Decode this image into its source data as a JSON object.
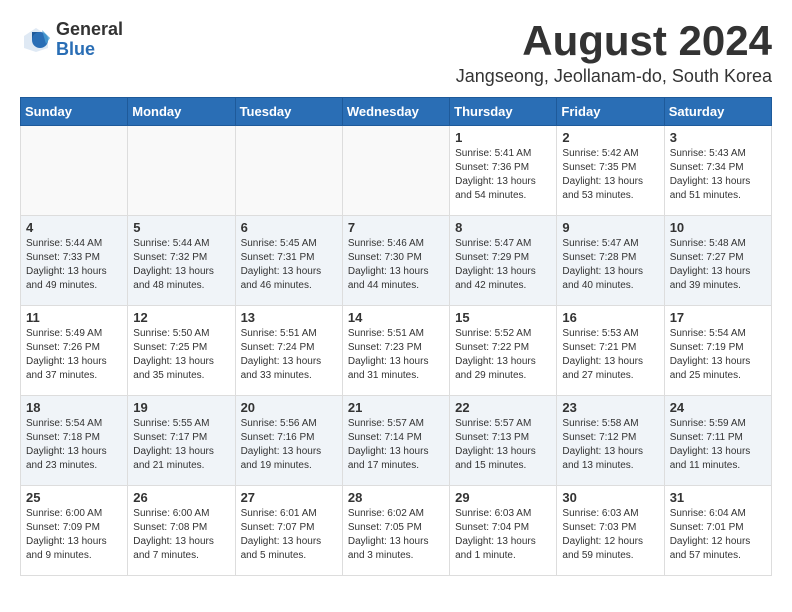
{
  "logo": {
    "line1": "General",
    "line2": "Blue"
  },
  "title": "August 2024",
  "location": "Jangseong, Jeollanam-do, South Korea",
  "headers": [
    "Sunday",
    "Monday",
    "Tuesday",
    "Wednesday",
    "Thursday",
    "Friday",
    "Saturday"
  ],
  "weeks": [
    [
      {
        "day": "",
        "info": ""
      },
      {
        "day": "",
        "info": ""
      },
      {
        "day": "",
        "info": ""
      },
      {
        "day": "",
        "info": ""
      },
      {
        "day": "1",
        "info": "Sunrise: 5:41 AM\nSunset: 7:36 PM\nDaylight: 13 hours\nand 54 minutes."
      },
      {
        "day": "2",
        "info": "Sunrise: 5:42 AM\nSunset: 7:35 PM\nDaylight: 13 hours\nand 53 minutes."
      },
      {
        "day": "3",
        "info": "Sunrise: 5:43 AM\nSunset: 7:34 PM\nDaylight: 13 hours\nand 51 minutes."
      }
    ],
    [
      {
        "day": "4",
        "info": "Sunrise: 5:44 AM\nSunset: 7:33 PM\nDaylight: 13 hours\nand 49 minutes."
      },
      {
        "day": "5",
        "info": "Sunrise: 5:44 AM\nSunset: 7:32 PM\nDaylight: 13 hours\nand 48 minutes."
      },
      {
        "day": "6",
        "info": "Sunrise: 5:45 AM\nSunset: 7:31 PM\nDaylight: 13 hours\nand 46 minutes."
      },
      {
        "day": "7",
        "info": "Sunrise: 5:46 AM\nSunset: 7:30 PM\nDaylight: 13 hours\nand 44 minutes."
      },
      {
        "day": "8",
        "info": "Sunrise: 5:47 AM\nSunset: 7:29 PM\nDaylight: 13 hours\nand 42 minutes."
      },
      {
        "day": "9",
        "info": "Sunrise: 5:47 AM\nSunset: 7:28 PM\nDaylight: 13 hours\nand 40 minutes."
      },
      {
        "day": "10",
        "info": "Sunrise: 5:48 AM\nSunset: 7:27 PM\nDaylight: 13 hours\nand 39 minutes."
      }
    ],
    [
      {
        "day": "11",
        "info": "Sunrise: 5:49 AM\nSunset: 7:26 PM\nDaylight: 13 hours\nand 37 minutes."
      },
      {
        "day": "12",
        "info": "Sunrise: 5:50 AM\nSunset: 7:25 PM\nDaylight: 13 hours\nand 35 minutes."
      },
      {
        "day": "13",
        "info": "Sunrise: 5:51 AM\nSunset: 7:24 PM\nDaylight: 13 hours\nand 33 minutes."
      },
      {
        "day": "14",
        "info": "Sunrise: 5:51 AM\nSunset: 7:23 PM\nDaylight: 13 hours\nand 31 minutes."
      },
      {
        "day": "15",
        "info": "Sunrise: 5:52 AM\nSunset: 7:22 PM\nDaylight: 13 hours\nand 29 minutes."
      },
      {
        "day": "16",
        "info": "Sunrise: 5:53 AM\nSunset: 7:21 PM\nDaylight: 13 hours\nand 27 minutes."
      },
      {
        "day": "17",
        "info": "Sunrise: 5:54 AM\nSunset: 7:19 PM\nDaylight: 13 hours\nand 25 minutes."
      }
    ],
    [
      {
        "day": "18",
        "info": "Sunrise: 5:54 AM\nSunset: 7:18 PM\nDaylight: 13 hours\nand 23 minutes."
      },
      {
        "day": "19",
        "info": "Sunrise: 5:55 AM\nSunset: 7:17 PM\nDaylight: 13 hours\nand 21 minutes."
      },
      {
        "day": "20",
        "info": "Sunrise: 5:56 AM\nSunset: 7:16 PM\nDaylight: 13 hours\nand 19 minutes."
      },
      {
        "day": "21",
        "info": "Sunrise: 5:57 AM\nSunset: 7:14 PM\nDaylight: 13 hours\nand 17 minutes."
      },
      {
        "day": "22",
        "info": "Sunrise: 5:57 AM\nSunset: 7:13 PM\nDaylight: 13 hours\nand 15 minutes."
      },
      {
        "day": "23",
        "info": "Sunrise: 5:58 AM\nSunset: 7:12 PM\nDaylight: 13 hours\nand 13 minutes."
      },
      {
        "day": "24",
        "info": "Sunrise: 5:59 AM\nSunset: 7:11 PM\nDaylight: 13 hours\nand 11 minutes."
      }
    ],
    [
      {
        "day": "25",
        "info": "Sunrise: 6:00 AM\nSunset: 7:09 PM\nDaylight: 13 hours\nand 9 minutes."
      },
      {
        "day": "26",
        "info": "Sunrise: 6:00 AM\nSunset: 7:08 PM\nDaylight: 13 hours\nand 7 minutes."
      },
      {
        "day": "27",
        "info": "Sunrise: 6:01 AM\nSunset: 7:07 PM\nDaylight: 13 hours\nand 5 minutes."
      },
      {
        "day": "28",
        "info": "Sunrise: 6:02 AM\nSunset: 7:05 PM\nDaylight: 13 hours\nand 3 minutes."
      },
      {
        "day": "29",
        "info": "Sunrise: 6:03 AM\nSunset: 7:04 PM\nDaylight: 13 hours\nand 1 minute."
      },
      {
        "day": "30",
        "info": "Sunrise: 6:03 AM\nSunset: 7:03 PM\nDaylight: 12 hours\nand 59 minutes."
      },
      {
        "day": "31",
        "info": "Sunrise: 6:04 AM\nSunset: 7:01 PM\nDaylight: 12 hours\nand 57 minutes."
      }
    ]
  ]
}
